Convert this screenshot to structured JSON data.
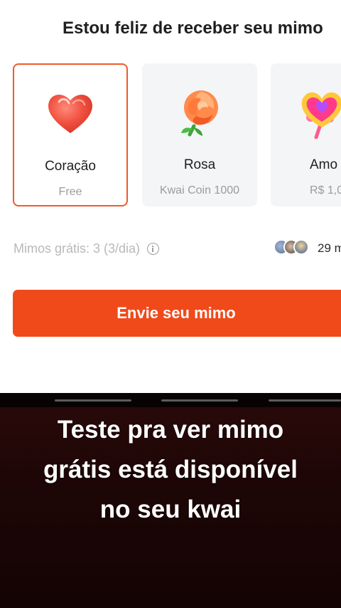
{
  "panel": {
    "title": "Estou feliz de receber seu mimo"
  },
  "gifts": [
    {
      "name": "Coração",
      "price": "Free",
      "icon": "heart-icon",
      "selected": true
    },
    {
      "name": "Rosa",
      "price": "Kwai Coin 1000",
      "icon": "rose-icon",
      "selected": false
    },
    {
      "name": "Amo",
      "price": "R$ 1,0",
      "icon": "heart-lollipop-icon",
      "selected": false
    }
  ],
  "free_gifts": {
    "label": "Mimos grátis: 3 (3/dia)",
    "icon": "info-icon"
  },
  "senders": {
    "count_text": "29 m"
  },
  "send_button": {
    "label": "Envie seu mimo"
  },
  "caption": {
    "line1": "Teste pra ver mimo",
    "line2": "grátis está disponível",
    "line3": "no seu kwai"
  },
  "colors": {
    "accent": "#f04a1a",
    "selected_border": "#f15a29",
    "card_bg": "#f4f5f7"
  }
}
